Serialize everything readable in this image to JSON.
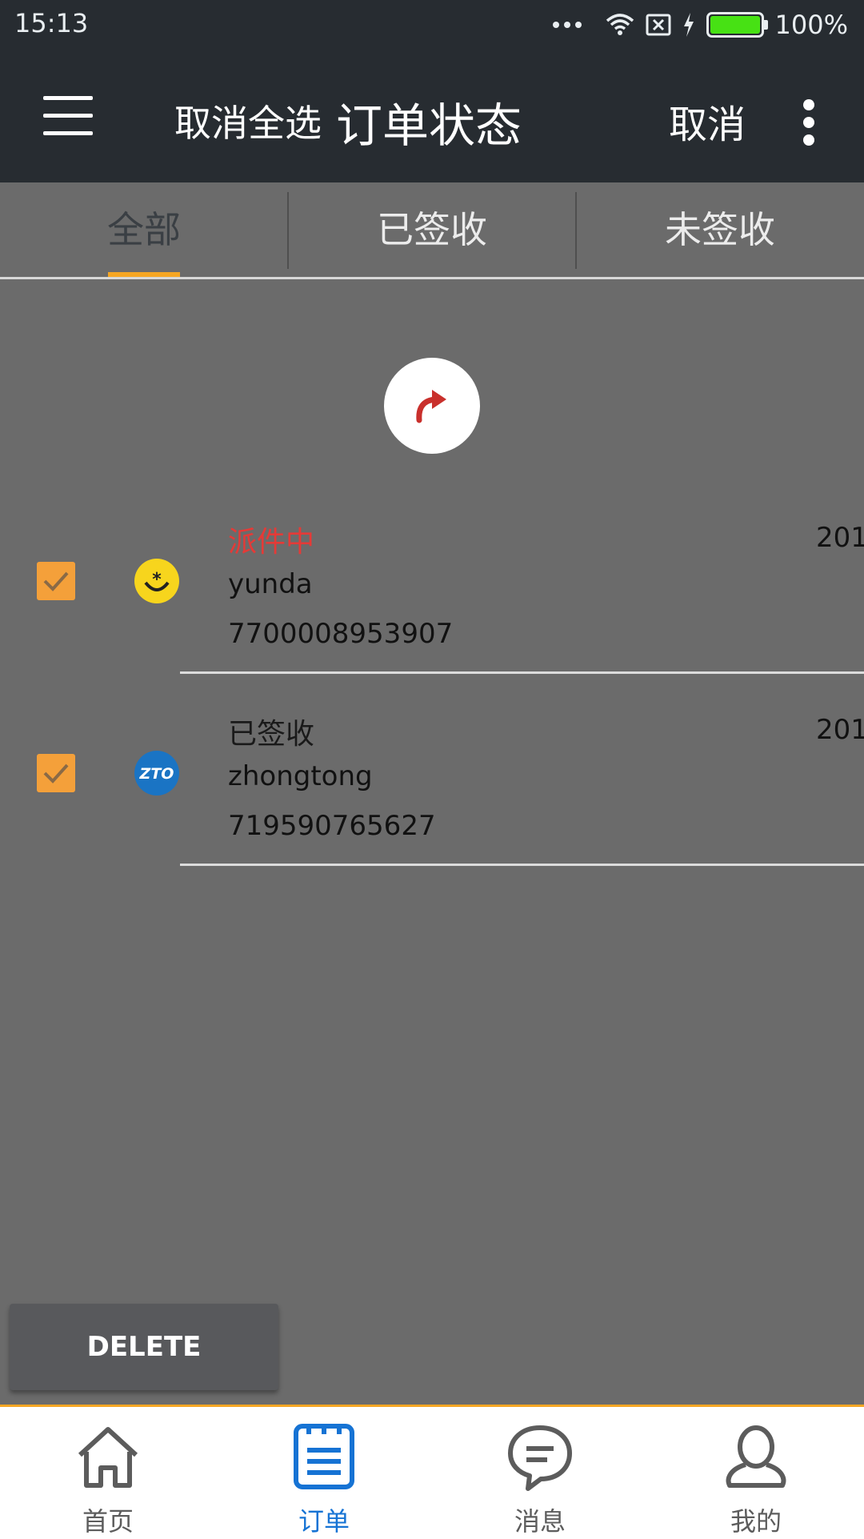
{
  "status_bar": {
    "time": "15:13",
    "battery": "100%"
  },
  "app_bar": {
    "select_all_label": "取消全选",
    "title": "订单状态",
    "cancel_label": "取消"
  },
  "tabs": [
    {
      "label": "全部",
      "active": true
    },
    {
      "label": "已签收",
      "active": false
    },
    {
      "label": "未签收",
      "active": false
    }
  ],
  "orders": [
    {
      "status": "派件中",
      "status_color": "#e53a37",
      "courier": "yunda",
      "tracking_number": "7700008953907",
      "date": "201",
      "checked": true,
      "logo_icon": "yunda-logo-icon"
    },
    {
      "status": "已签收",
      "status_color": "#1a1a1a",
      "courier": "zhongtong",
      "tracking_number": "719590765627",
      "date": "201",
      "checked": true,
      "logo_icon": "zto-logo-icon",
      "logo_text": "ZTO"
    }
  ],
  "actions": {
    "delete_label": "DELETE"
  },
  "bottom_nav": [
    {
      "label": "首页",
      "icon": "home-icon",
      "active": false
    },
    {
      "label": "订单",
      "icon": "orders-icon",
      "active": true
    },
    {
      "label": "消息",
      "icon": "message-icon",
      "active": false
    },
    {
      "label": "我的",
      "icon": "profile-icon",
      "active": false
    }
  ],
  "colors": {
    "accent": "#f6a623",
    "active_nav": "#1673d4",
    "checkbox": "#f4a03a",
    "status_in_transit": "#e53a37"
  }
}
